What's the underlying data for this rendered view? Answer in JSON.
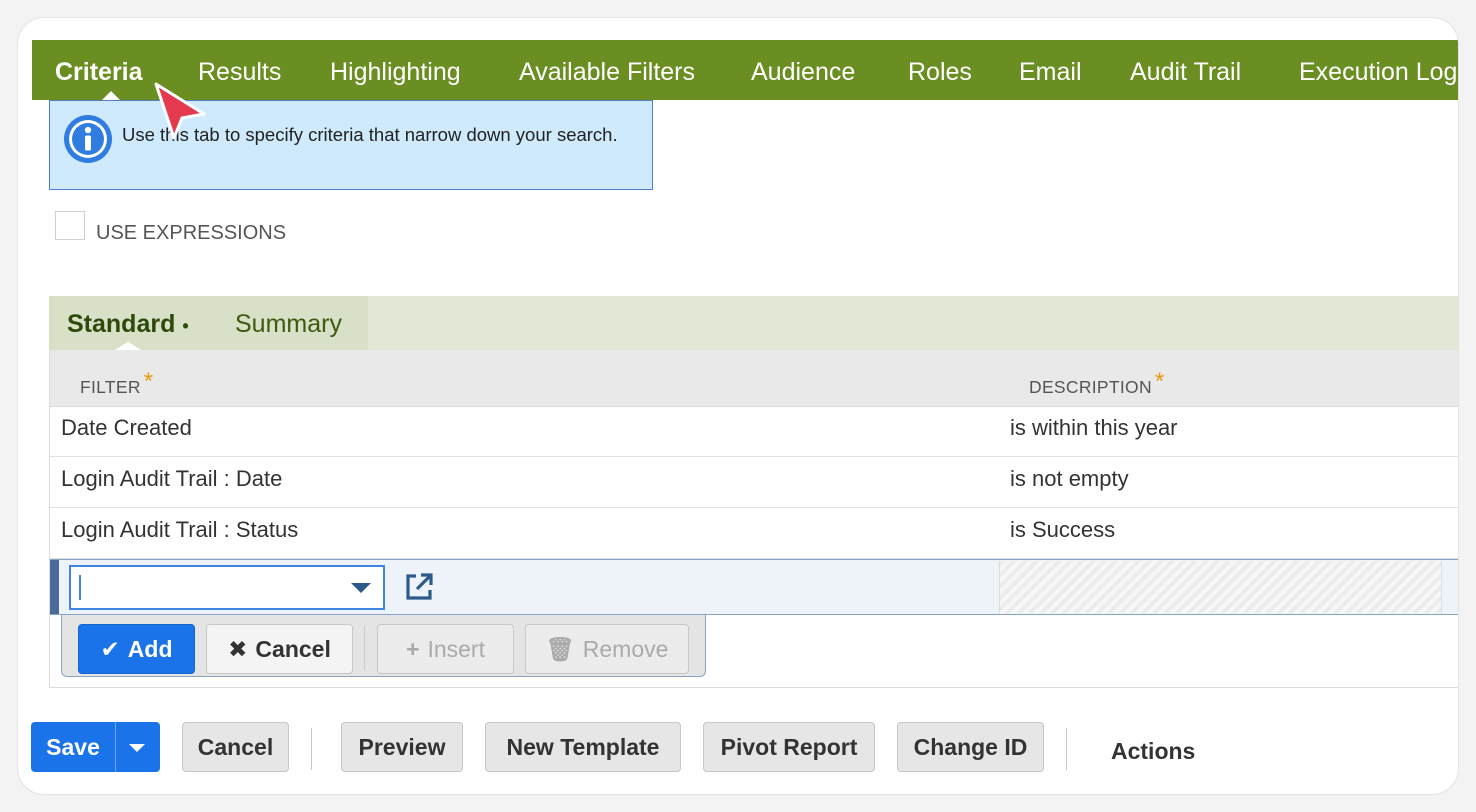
{
  "top_tabs": [
    {
      "label": "Criteria",
      "active": true
    },
    {
      "label": "Results"
    },
    {
      "label": "Highlighting"
    },
    {
      "label": "Available Filters"
    },
    {
      "label": "Audience"
    },
    {
      "label": "Roles"
    },
    {
      "label": "Email"
    },
    {
      "label": "Audit Trail"
    },
    {
      "label": "Execution Log"
    }
  ],
  "info": {
    "text": "Use this tab to specify criteria that narrow down your search."
  },
  "use_expressions": {
    "label": "USE EXPRESSIONS",
    "checked": false
  },
  "sub_tabs": [
    {
      "label": "Standard",
      "marker": "•",
      "active": true
    },
    {
      "label": "Summary"
    }
  ],
  "table": {
    "columns": [
      "FILTER",
      "DESCRIPTION"
    ],
    "required_marker": "*",
    "rows": [
      {
        "filter": "Date Created",
        "description": "is within this year"
      },
      {
        "filter": "Login Audit Trail : Date",
        "description": "is not empty"
      },
      {
        "filter": "Login Audit Trail : Status",
        "description": "is Success"
      }
    ],
    "edit_row": {
      "select_value": ""
    }
  },
  "row_buttons": {
    "add": "Add",
    "cancel": "Cancel",
    "insert": "Insert",
    "remove": "Remove"
  },
  "footer": {
    "save": "Save",
    "cancel": "Cancel",
    "preview": "Preview",
    "new_template": "New Template",
    "pivot_report": "Pivot Report",
    "change_id": "Change ID",
    "actions": "Actions"
  },
  "colors": {
    "tab_bar": "#6b8e23",
    "primary": "#1a73e8",
    "info_bg": "#cfeafc",
    "required": "#e39c0c"
  }
}
